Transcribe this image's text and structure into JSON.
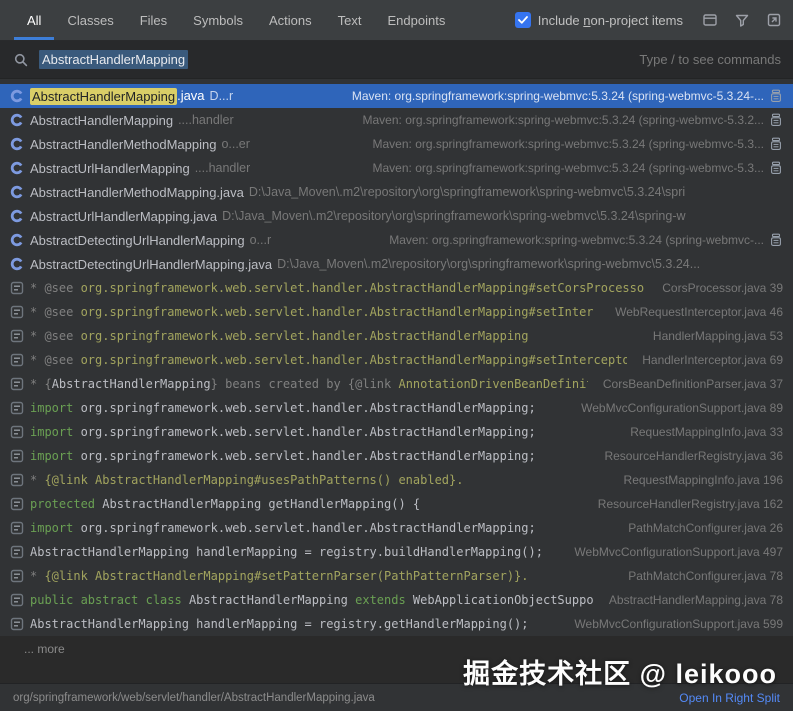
{
  "header": {
    "tabs": [
      {
        "label": "All",
        "active": true
      },
      {
        "label": "Classes",
        "active": false
      },
      {
        "label": "Files",
        "active": false
      },
      {
        "label": "Symbols",
        "active": false
      },
      {
        "label": "Actions",
        "active": false
      },
      {
        "label": "Text",
        "active": false
      },
      {
        "label": "Endpoints",
        "active": false
      }
    ],
    "checkbox": {
      "pre": "Include ",
      "mnemonic": "n",
      "post": "on-project items",
      "checked": true
    }
  },
  "search": {
    "query": "AbstractHandlerMapping",
    "hint": "Type / to see commands"
  },
  "colors": {
    "accent": "#3574f0",
    "selection": "#2f65ba",
    "match_highlight": "#d9ce67",
    "keyword_green": "#6aa053",
    "javadoc_olive": "#a2a45e"
  },
  "results": [
    {
      "icon": "class",
      "selected": true,
      "segments": [
        {
          "t": "AbstractHandlerMapping",
          "s": "hl"
        },
        {
          "t": ".java",
          "s": "plain"
        }
      ],
      "loc": "D...r",
      "right": "Maven: org.springframework:spring-webmvc:5.3.24 (spring-webmvc-5.3.24-...",
      "jar": true
    },
    {
      "icon": "class",
      "segments": [
        {
          "t": "AbstractHandlerMapping",
          "s": "plain"
        }
      ],
      "loc": "....handler",
      "right": "Maven: org.springframework:spring-webmvc:5.3.24 (spring-webmvc-5.3.2...",
      "jar": true
    },
    {
      "icon": "class",
      "segments": [
        {
          "t": "AbstractHandlerMethodMapping",
          "s": "plain"
        }
      ],
      "loc": "o...er",
      "right": "Maven: org.springframework:spring-webmvc:5.3.24 (spring-webmvc-5.3...",
      "jar": true
    },
    {
      "icon": "class",
      "segments": [
        {
          "t": "AbstractUrlHandlerMapping",
          "s": "plain"
        }
      ],
      "loc": "....handler",
      "right": "Maven: org.springframework:spring-webmvc:5.3.24 (spring-webmvc-5.3...",
      "jar": true
    },
    {
      "icon": "class",
      "segments": [
        {
          "t": "AbstractHandlerMethodMapping.java",
          "s": "plain"
        }
      ],
      "loc": "D:\\Java_Moven\\.m2\\repository\\org\\springframework\\spring-webmvc\\5.3.24\\spri"
    },
    {
      "icon": "class",
      "segments": [
        {
          "t": "AbstractUrlHandlerMapping.java",
          "s": "plain"
        }
      ],
      "loc": "D:\\Java_Moven\\.m2\\repository\\org\\springframework\\spring-webmvc\\5.3.24\\spring-w"
    },
    {
      "icon": "class",
      "segments": [
        {
          "t": "AbstractDetectingUrlHandlerMapping",
          "s": "plain"
        }
      ],
      "loc": "o...r",
      "right": "Maven: org.springframework:spring-webmvc:5.3.24 (spring-webmvc-...",
      "jar": true
    },
    {
      "icon": "class",
      "segments": [
        {
          "t": "AbstractDetectingUrlHandlerMapping.java",
          "s": "plain"
        }
      ],
      "loc": "D:\\Java_Moven\\.m2\\repository\\org\\springframework\\spring-webmvc\\5.3.24..."
    },
    {
      "icon": "text",
      "segments": [
        {
          "t": "* @see ",
          "s": "dim"
        },
        {
          "t": "org.springframework.web.servlet.handler.AbstractHandlerMapping#setCorsProcesso",
          "s": "olive"
        }
      ],
      "right": "CorsProcessor.java 39"
    },
    {
      "icon": "text",
      "segments": [
        {
          "t": "* @see ",
          "s": "dim"
        },
        {
          "t": "org.springframework.web.servlet.handler.AbstractHandlerMapping#setInter",
          "s": "olive"
        }
      ],
      "right": "WebRequestInterceptor.java 46"
    },
    {
      "icon": "text",
      "segments": [
        {
          "t": "* @see ",
          "s": "dim"
        },
        {
          "t": "org.springframework.web.servlet.handler.AbstractHandlerMapping",
          "s": "olive"
        }
      ],
      "right": "HandlerMapping.java 53"
    },
    {
      "icon": "text",
      "segments": [
        {
          "t": "* @see ",
          "s": "dim"
        },
        {
          "t": "org.springframework.web.servlet.handler.AbstractHandlerMapping#setIntercepto",
          "s": "olive"
        }
      ],
      "right": "HandlerInterceptor.java 69"
    },
    {
      "icon": "text",
      "segments": [
        {
          "t": "* {",
          "s": "dim"
        },
        {
          "t": "AbstractHandlerMapping",
          "s": "plain"
        },
        {
          "t": "} beans created by {@link ",
          "s": "dim"
        },
        {
          "t": "AnnotationDrivenBeanDefiniti",
          "s": "olive"
        }
      ],
      "right": "CorsBeanDefinitionParser.java 37"
    },
    {
      "icon": "text",
      "segments": [
        {
          "t": "import ",
          "s": "green"
        },
        {
          "t": "org.springframework.web.servlet.handler.AbstractHandlerMapping;",
          "s": "plain"
        }
      ],
      "right": "WebMvcConfigurationSupport.java 89"
    },
    {
      "icon": "text",
      "segments": [
        {
          "t": "import ",
          "s": "green"
        },
        {
          "t": "org.springframework.web.servlet.handler.AbstractHandlerMapping;",
          "s": "plain"
        }
      ],
      "right": "RequestMappingInfo.java 33"
    },
    {
      "icon": "text",
      "segments": [
        {
          "t": "import ",
          "s": "green"
        },
        {
          "t": "org.springframework.web.servlet.handler.AbstractHandlerMapping;",
          "s": "plain"
        }
      ],
      "right": "ResourceHandlerRegistry.java 36"
    },
    {
      "icon": "text",
      "segments": [
        {
          "t": "* ",
          "s": "dim"
        },
        {
          "t": "{@link AbstractHandlerMapping#usesPathPatterns() enabled}.",
          "s": "olive"
        }
      ],
      "right": "RequestMappingInfo.java 196"
    },
    {
      "icon": "text",
      "segments": [
        {
          "t": "protected ",
          "s": "green"
        },
        {
          "t": "AbstractHandlerMapping getHandlerMapping() {",
          "s": "plain"
        }
      ],
      "right": "ResourceHandlerRegistry.java 162"
    },
    {
      "icon": "text",
      "segments": [
        {
          "t": "import ",
          "s": "green"
        },
        {
          "t": "org.springframework.web.servlet.handler.AbstractHandlerMapping;",
          "s": "plain"
        }
      ],
      "right": "PathMatchConfigurer.java 26"
    },
    {
      "icon": "text",
      "segments": [
        {
          "t": "AbstractHandlerMapping handlerMapping = registry.buildHandlerMapping();",
          "s": "plain"
        }
      ],
      "right": "WebMvcConfigurationSupport.java 497"
    },
    {
      "icon": "text",
      "segments": [
        {
          "t": "* ",
          "s": "dim"
        },
        {
          "t": "{@link AbstractHandlerMapping#setPatternParser(PathPatternParser)}.",
          "s": "olive"
        }
      ],
      "right": "PathMatchConfigurer.java 78"
    },
    {
      "icon": "text",
      "segments": [
        {
          "t": "public abstract class ",
          "s": "green"
        },
        {
          "t": "AbstractHandlerMapping ",
          "s": "plain"
        },
        {
          "t": "extends ",
          "s": "green"
        },
        {
          "t": "WebApplicationObjectSuppo",
          "s": "plain"
        }
      ],
      "right": "AbstractHandlerMapping.java 78"
    },
    {
      "icon": "text",
      "segments": [
        {
          "t": "AbstractHandlerMapping handlerMapping = registry.getHandlerMapping();",
          "s": "plain"
        }
      ],
      "right": "WebMvcConfigurationSupport.java 599"
    }
  ],
  "more_label": "... more",
  "watermark": "掘金技术社区 @ leikooo",
  "footer": {
    "path": "org/springframework/web/servlet/handler/AbstractHandlerMapping.java",
    "action": "Open In Right Split"
  }
}
